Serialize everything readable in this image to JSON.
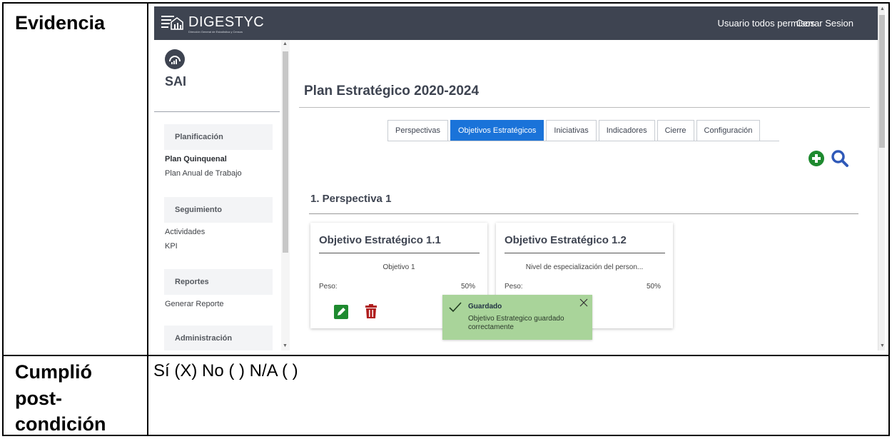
{
  "doc": {
    "evidence_label": "Evidencia",
    "postcondition_label_1": "Cumplió",
    "postcondition_label_2": "post-",
    "postcondition_label_3": "condición",
    "answer": "Sí (X) No ( )  N/A ( )"
  },
  "header": {
    "brand": "DIGESTYC",
    "brand_sub": "Dirección General de Estadística y Censos",
    "user": "Usuario todos permisos",
    "logout": "Cerrar Sesion"
  },
  "sidebar": {
    "app_name": "SAI",
    "sections": [
      {
        "title": "Planificación",
        "links": [
          "Plan Quinquenal",
          "Plan Anual de Trabajo"
        ]
      },
      {
        "title": "Seguimiento",
        "links": [
          "Actividades",
          "KPI"
        ]
      },
      {
        "title": "Reportes",
        "links": [
          "Generar Reporte"
        ]
      },
      {
        "title": "Administración",
        "links": []
      }
    ]
  },
  "main": {
    "title": "Plan Estratégico 2020-2024",
    "tabs": [
      "Perspectivas",
      "Objetivos Estratégicos",
      "Iniciativas",
      "Indicadores",
      "Cierre",
      "Configuración"
    ],
    "active_tab": "Objetivos Estratégicos",
    "perspective_title": "1. Perspectiva 1",
    "cards": [
      {
        "title": "Objetivo Estratégico 1.1",
        "description": "Objetivo 1",
        "weight_label": "Peso:",
        "weight": "50%"
      },
      {
        "title": "Objetivo Estratégico 1.2",
        "description": "Nivel de especialización del person...",
        "weight_label": "Peso:",
        "weight": "50%"
      }
    ]
  },
  "toast": {
    "title": "Guardado",
    "message": "Objetivo Estrategico guardado correctamente"
  },
  "colors": {
    "topbar": "#3e4451",
    "active_tab": "#1a73d9",
    "success": "#1e8a2f",
    "danger": "#b01e1e",
    "toast_bg": "#a9d49a"
  }
}
